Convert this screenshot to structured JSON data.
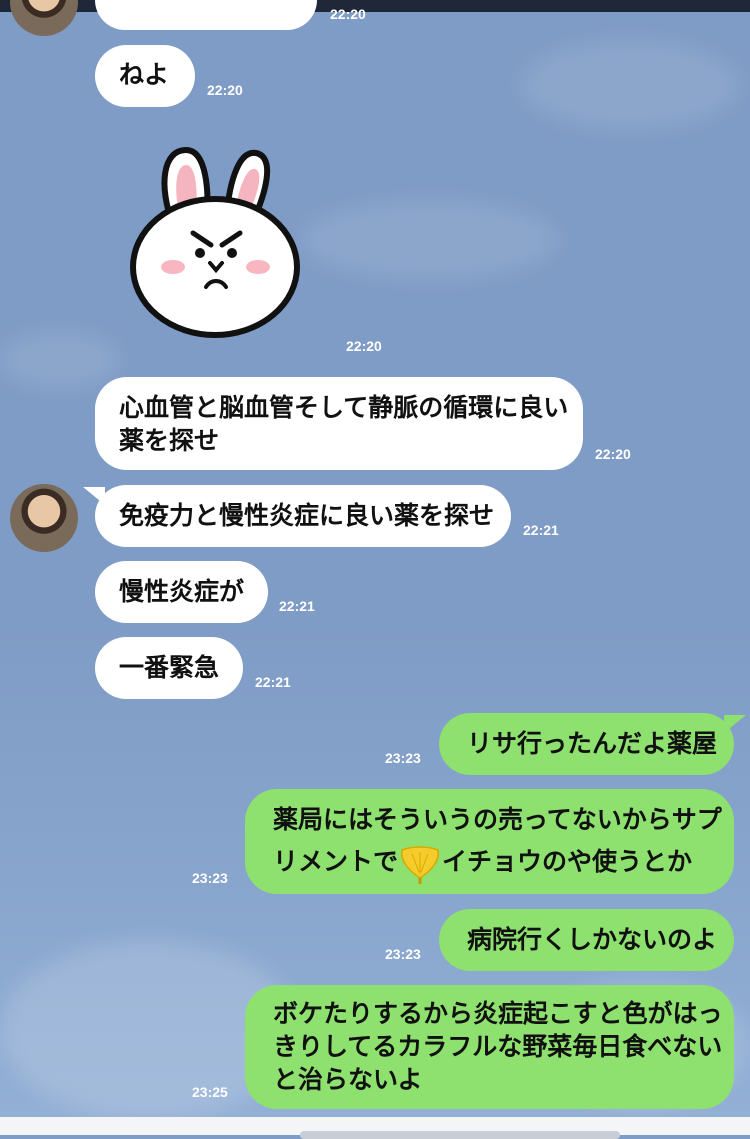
{
  "colors": {
    "background": "#7f9cc6",
    "incoming_bubble": "#ffffff",
    "outgoing_bubble": "#8ee06f",
    "timestamp": "#ffffff"
  },
  "messages": [
    {
      "id": "m0",
      "side": "incoming",
      "text": "",
      "time": "22:20"
    },
    {
      "id": "m1",
      "side": "incoming",
      "text": "ねよ",
      "time": "22:20"
    },
    {
      "id": "m2",
      "side": "incoming",
      "type": "sticker",
      "sticker": "angry-bunny-sticker",
      "time": "22:20"
    },
    {
      "id": "m3",
      "side": "incoming",
      "lines": [
        "心血管と脳血管そして静脈の循環に良い",
        "薬を探せ"
      ],
      "time": "22:20"
    },
    {
      "id": "m4",
      "side": "incoming",
      "text": "免疫力と慢性炎症に良い薬を探せ",
      "time": "22:21"
    },
    {
      "id": "m5",
      "side": "incoming",
      "text": "慢性炎症が",
      "time": "22:21"
    },
    {
      "id": "m6",
      "side": "incoming",
      "text": "一番緊急",
      "time": "22:21"
    },
    {
      "id": "m7",
      "side": "outgoing",
      "text": "リサ行ったんだよ薬屋",
      "time": "23:23"
    },
    {
      "id": "m8",
      "side": "outgoing",
      "lines": [
        "薬局にはそういうの売ってないからサプ",
        "リメントで",
        "イチョウのや使うとか"
      ],
      "emoji": "ginkgo-leaf-icon",
      "time": "23:23"
    },
    {
      "id": "m9",
      "side": "outgoing",
      "text": "病院行くしかないのよ",
      "time": "23:23"
    },
    {
      "id": "m10",
      "side": "outgoing",
      "lines": [
        "ボケたりするから炎症起こすと色がはっ",
        "きりしてるカラフルな野菜毎日食べない",
        "と治らないよ"
      ],
      "time": "23:25"
    }
  ]
}
